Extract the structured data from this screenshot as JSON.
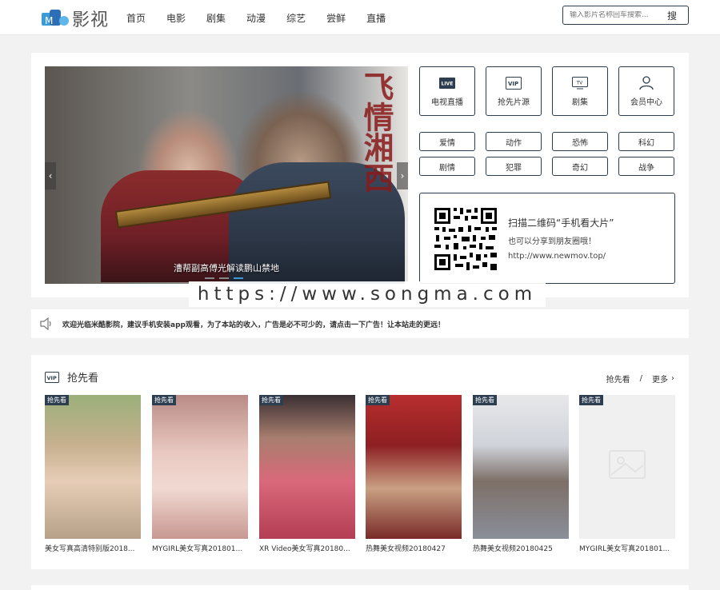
{
  "header": {
    "logo_text": "影视",
    "nav": [
      "首页",
      "电影",
      "剧集",
      "动漫",
      "综艺",
      "尝鲜",
      "直播"
    ],
    "search_placeholder": "输入影片名称回车搜索...",
    "search_button": "搜"
  },
  "slider": {
    "caption": "漕帮副高傅光解读鹏山禁地",
    "poster_text": "飞情湘西",
    "dots": 3,
    "active_dot": 3
  },
  "categories": [
    {
      "label": "电视直播",
      "icon": "live-icon",
      "icon_text": "LIVE"
    },
    {
      "label": "抢先片源",
      "icon": "vip-icon",
      "icon_text": "VIP"
    },
    {
      "label": "剧集",
      "icon": "tv-icon",
      "icon_text": "TV"
    },
    {
      "label": "会员中心",
      "icon": "user-icon",
      "icon_text": ""
    }
  ],
  "genres": [
    "爱情",
    "动作",
    "恐怖",
    "科幻",
    "剧情",
    "犯罪",
    "奇幻",
    "战争"
  ],
  "qr": {
    "title": "扫描二维码“手机看大片”",
    "subtitle": "也可以分享到朋友圈哦！",
    "url": "http://www.newmov.top/"
  },
  "watermark": "https://www.songma.com",
  "notice": "欢迎光临米酷影院，建议手机安装app观看，为了本站的收入，广告是必不可少的，请点击一下广告！让本站走的更远！",
  "vip_section": {
    "title": "抢先看",
    "link_label": "抢先看",
    "separator": "/",
    "more_label": "更多",
    "badge": "抢先看",
    "items": [
      {
        "caption": "美女写真高清特别版2018..."
      },
      {
        "caption": "MYGIRL美女写真201801..."
      },
      {
        "caption": "XR Video美女写真20180..."
      },
      {
        "caption": "热舞美女视频20180427"
      },
      {
        "caption": "热舞美女视频20180425"
      },
      {
        "caption": "MYGIRL美女写真201801..."
      }
    ]
  },
  "colors": {
    "accent": "#2d3e50",
    "active_dot": "#3a9bd9"
  }
}
